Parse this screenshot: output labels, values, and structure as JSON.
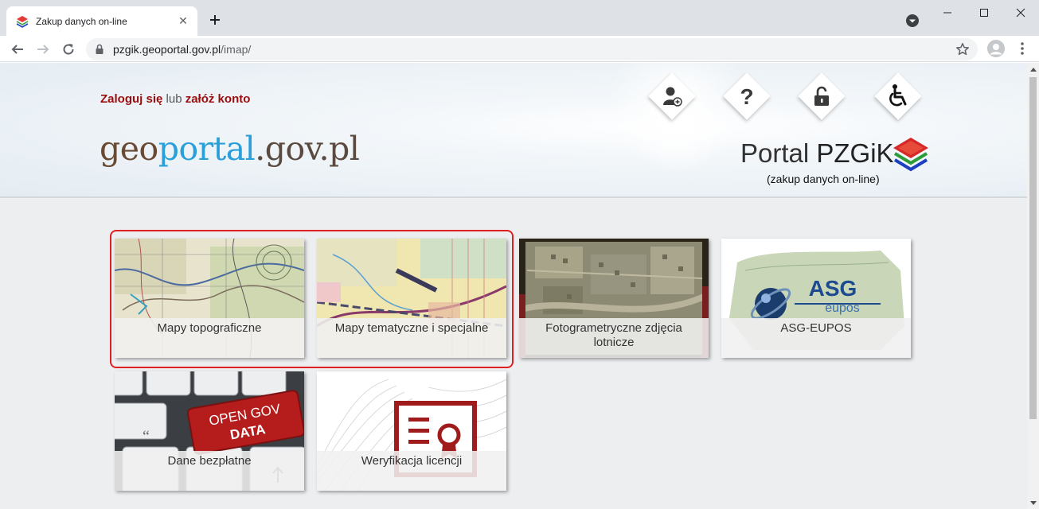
{
  "browser": {
    "tab_title": "Zakup danych on-line",
    "url_host": "pzgik.geoportal.gov.pl",
    "url_path": "/imap/"
  },
  "header": {
    "login_label": "Zaloguj się",
    "login_separator": " lub ",
    "register_label": "załóż konto",
    "logo_part1": "geo",
    "logo_part2": "portal",
    "logo_part3": ".gov.pl",
    "portal_title_thin": "Portal ",
    "portal_title_bold": "PZGiK",
    "portal_subtitle": "(zakup danych on-line)",
    "icons": [
      "add-user-icon",
      "help-icon",
      "unlock-icon",
      "accessibility-icon"
    ]
  },
  "tiles": [
    {
      "label": "Mapy topograficzne"
    },
    {
      "label": "Mapy tematyczne i specjalne"
    },
    {
      "label": "Fotogrametryczne zdjęcia lotnicze"
    },
    {
      "label": "ASG-EUPOS"
    },
    {
      "label": "Dane bezpłatne"
    },
    {
      "label": "Weryfikacja licencji"
    }
  ],
  "tile_art": {
    "asg_logo": "ASG",
    "asg_sub": "eupos",
    "open_gov": "OPEN GOV",
    "open_data": "DATA"
  },
  "colors": {
    "accent_red": "#9b0d0d",
    "highlight": "#e02020",
    "geo_blue": "#2a9fd8"
  }
}
